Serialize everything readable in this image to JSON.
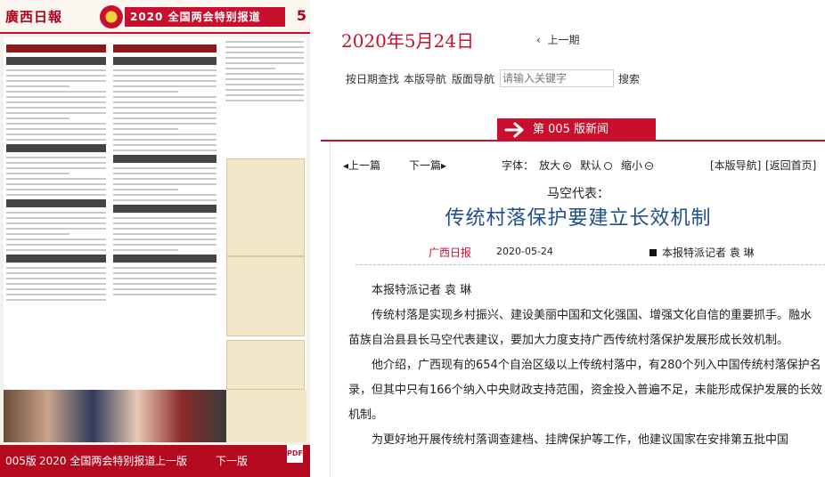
{
  "paper": {
    "logo": "廣西日報",
    "banner": "2020 全国两会特别报道",
    "page_number": "5"
  },
  "left_bar": {
    "page_label": "005版",
    "section_label": "2020  全国两会特别报道",
    "prev_label": "上一版",
    "next_label": "下一版",
    "pdf_icon": "pdf-icon"
  },
  "header": {
    "date": "2020年5月24日",
    "prev_issue": "上一期"
  },
  "search": {
    "by_date": "按日期查找",
    "page_nav": "本版导航",
    "layout_nav": "版面导航",
    "placeholder": "请输入关键字",
    "button": "搜索"
  },
  "section": {
    "label": "第 005 版新闻"
  },
  "toolbar": {
    "prev_article": "上一篇",
    "next_article": "下一篇",
    "font_label": "字体：",
    "enlarge": "放大",
    "default": "默认",
    "shrink": "缩小",
    "page_nav": "[本版导航]",
    "home": "[返回首页]"
  },
  "article": {
    "subtitle": "马空代表：",
    "title": "传统村落保护要建立长效机制",
    "source": "广西日报",
    "date": "2020-05-24",
    "author": "本报特派记者 袁 琳",
    "paragraphs": [
      "本报特派记者 袁 琳",
      "传统村落是实现乡村振兴、建设美丽中国和文化强国、增强文化自信的重要抓手。融水苗族自治县县长马空代表建议，要加大力度支持广西传统村落保护发展形成长效机制。",
      "他介绍，广西现有的654个自治区级以上传统村落中，有280个列入中国传统村落保护名录，但其中只有166个纳入中央财政支持范围，资金投入普遍不足，未能形成保护发展的长效机制。",
      "为更好地开展传统村落调查建档、挂牌保护等工作，他建议国家在安排第五批中国"
    ]
  },
  "colors": {
    "accent_red": "#c8102e",
    "title_blue": "#1f4e8c"
  }
}
